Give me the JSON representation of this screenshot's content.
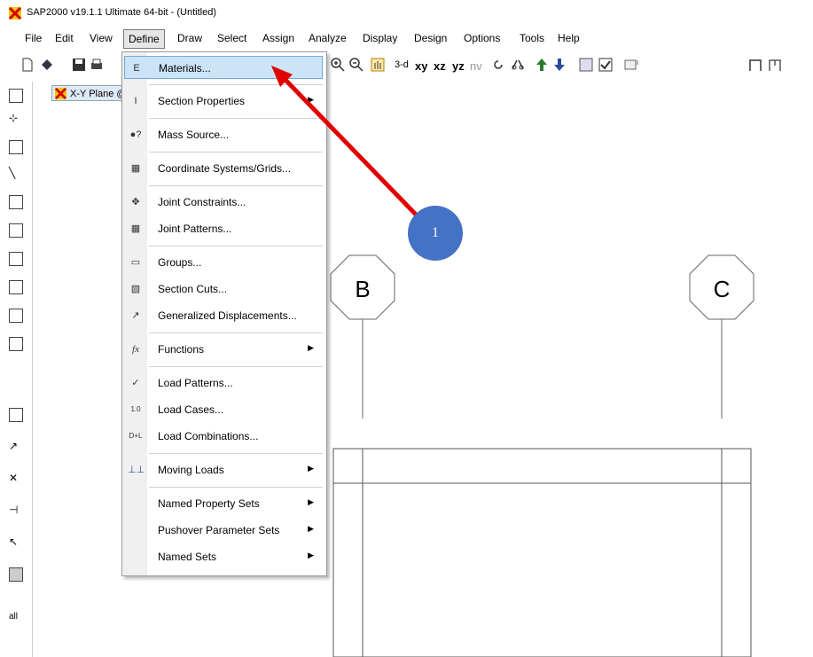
{
  "window": {
    "title": "SAP2000 v19.1.1 Ultimate 64-bit - (Untitled)"
  },
  "menubar": [
    "File",
    "Edit",
    "View",
    "Define",
    "Draw",
    "Select",
    "Assign",
    "Analyze",
    "Display",
    "Design",
    "Options",
    "Tools",
    "Help"
  ],
  "active_menu": "Define",
  "toolbar": {
    "view_labels": [
      "3-d",
      "xy",
      "xz",
      "yz",
      "nv"
    ]
  },
  "view_tab": {
    "label": "X-Y Plane @"
  },
  "define_menu": {
    "items": [
      {
        "label": "Materials...",
        "icon": "materials-icon",
        "glyph": "E"
      },
      {
        "label": "Section Properties",
        "icon": "section-properties-icon",
        "glyph": "I",
        "submenu": true
      },
      {
        "label": "Mass Source...",
        "icon": "mass-source-icon",
        "glyph": "●?"
      },
      {
        "label": "Coordinate Systems/Grids...",
        "icon": "grid-icon",
        "glyph": "▦"
      },
      {
        "label": "Joint Constraints...",
        "icon": "joint-constraints-icon",
        "glyph": "✥"
      },
      {
        "label": "Joint Patterns...",
        "icon": "joint-patterns-icon",
        "glyph": "▦"
      },
      {
        "label": "Groups...",
        "icon": "groups-icon",
        "glyph": "▭"
      },
      {
        "label": "Section Cuts...",
        "icon": "section-cuts-icon",
        "glyph": "▧"
      },
      {
        "label": "Generalized Displacements...",
        "icon": "displacement-icon",
        "glyph": "↗"
      },
      {
        "label": "Functions",
        "icon": "functions-icon",
        "glyph": "fx",
        "submenu": true
      },
      {
        "label": "Load Patterns...",
        "icon": "load-patterns-icon",
        "glyph": "✓"
      },
      {
        "label": "Load Cases...",
        "icon": "load-cases-icon",
        "glyph": "1.0"
      },
      {
        "label": "Load Combinations...",
        "icon": "load-combinations-icon",
        "glyph": "D+L"
      },
      {
        "label": "Moving Loads",
        "icon": "moving-loads-icon",
        "glyph": "⊥⊥",
        "submenu": true
      },
      {
        "label": "Named Property Sets",
        "icon": "",
        "glyph": "",
        "submenu": true
      },
      {
        "label": "Pushover Parameter Sets",
        "icon": "",
        "glyph": "",
        "submenu": true
      },
      {
        "label": "Named Sets",
        "icon": "",
        "glyph": "",
        "submenu": true
      }
    ]
  },
  "grid_bubbles": [
    "B",
    "C"
  ],
  "callout": {
    "number": "1"
  }
}
